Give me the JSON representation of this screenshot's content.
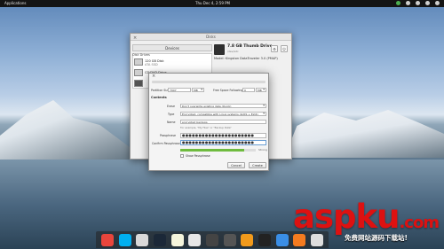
{
  "top_panel": {
    "apps": "Applications",
    "clock": "Thu Dec 4, 2:59 PM"
  },
  "window": {
    "title": "Disks",
    "sidebar_header": "Devices",
    "sidebar_group": "Disk Drives",
    "disks": [
      {
        "label": "120 GB Disk",
        "sub": "ATA SSD"
      },
      {
        "label": "CD/DVD Drive",
        "sub": ""
      },
      {
        "label": "",
        "sub": ""
      }
    ],
    "drive_title": "7.8 GB Thumb Drive",
    "drive_sub": "/dev/sdc",
    "model": "Model: Kingston DataTraveler 3.0 (PMAP)",
    "header_buttons": [
      "⚙",
      "⏻"
    ]
  },
  "dialog": {
    "title": "",
    "partition_size_label": "Partition Size",
    "partition_size": "7907",
    "free_space_label": "Free Space Following",
    "free_space": "0",
    "unit": "MB",
    "contents_label": "Contents",
    "erase_label": "Erase",
    "erase_value": "Don't overwrite existing data (Quick)",
    "type_label": "Type",
    "type_value": "Encrypted, compatible with Linux systems (LUKS + Ext4)",
    "name_label": "Name",
    "name_value": "encrypted backups",
    "name_hint": "For example, \"My Files\" or \"Backup Data\"",
    "passphrase_label": "Passphrase",
    "passphrase_value": "●●●●●●●●●●●●●●●●●●●●●●",
    "confirm_label": "Confirm Passphrase",
    "confirm_value": "●●●●●●●●●●●●●●●●●●●●●●",
    "strength_label": "Strong",
    "strength_fraction": 0.85,
    "show_passphrase_label": "Show Passphrase",
    "cancel": "Cancel",
    "create": "Create"
  },
  "dock": {
    "icons": [
      {
        "name": "chrome-icon",
        "color": "#e8453c"
      },
      {
        "name": "skype-icon",
        "color": "#00aff0"
      },
      {
        "name": "files-icon",
        "color": "#d9d9d9"
      },
      {
        "name": "steam-icon",
        "color": "#1b2838"
      },
      {
        "name": "notes-icon",
        "color": "#f5f5dc"
      },
      {
        "name": "document-icon",
        "color": "#e6e6e6"
      },
      {
        "name": "terminal-icon",
        "color": "#444444"
      },
      {
        "name": "photos-icon",
        "color": "#555555"
      },
      {
        "name": "music-icon",
        "color": "#f19a1b"
      },
      {
        "name": "console-icon",
        "color": "#222222"
      },
      {
        "name": "mail-icon",
        "color": "#3a8ee6"
      },
      {
        "name": "update-icon",
        "color": "#f47b20"
      },
      {
        "name": "trash-icon",
        "color": "#dddddd"
      }
    ]
  },
  "watermark": {
    "main": "aspku",
    "tld": ".com",
    "sub": "免费网站源码下载站!"
  }
}
